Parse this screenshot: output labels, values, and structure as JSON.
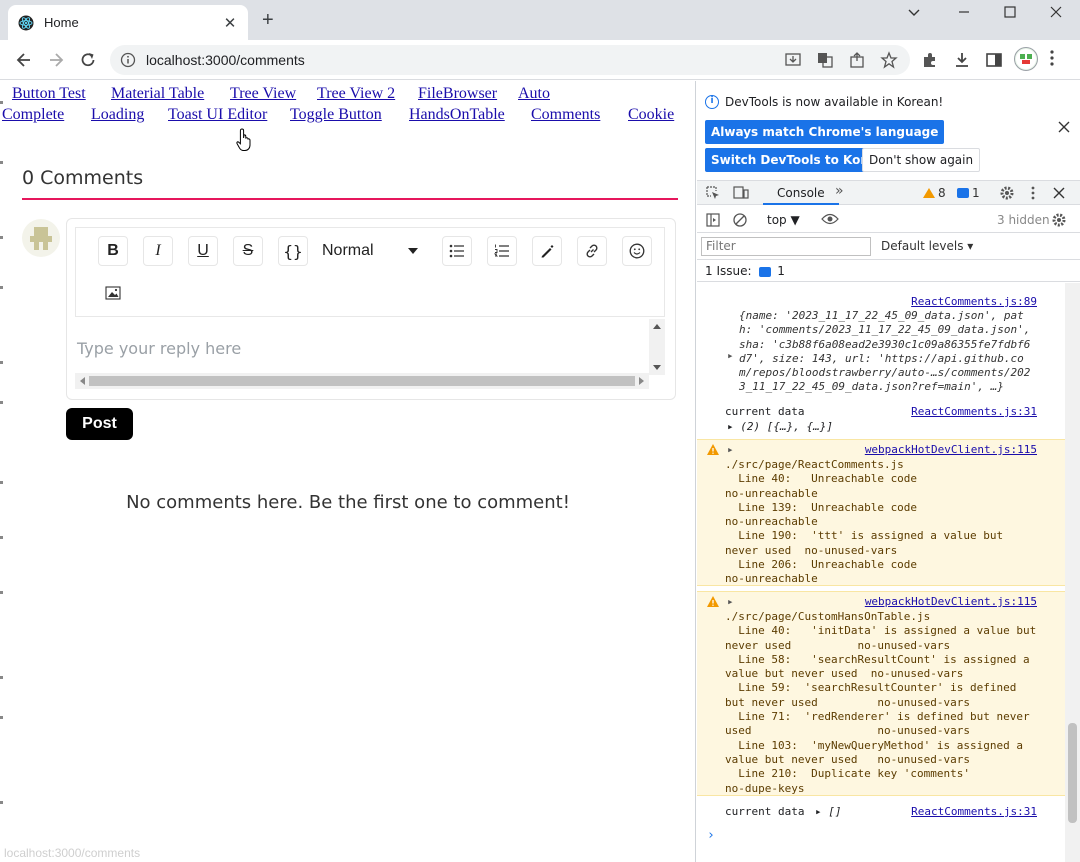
{
  "browser": {
    "tab_title": "Home",
    "tab_close": "✕",
    "new_tab": "+",
    "url": "localhost:3000/comments"
  },
  "nav_links": [
    "Button Test",
    "Material Table",
    "Tree View",
    "Tree View 2",
    "FileBrowser",
    "Auto",
    "Complete",
    "Loading",
    "Toast UI Editor",
    "Toggle Button",
    "HandsOnTable",
    "Comments",
    "Cookie"
  ],
  "comments": {
    "title": "0 Comments",
    "format_select": "Normal",
    "placeholder": "Type your reply here",
    "post_label": "Post",
    "empty_message": "No comments here. Be the first one to comment!",
    "status_url": "localhost:3000/comments"
  },
  "editor_toolbar": {
    "bold": "B",
    "italic": "I",
    "underline": "U",
    "strike": "S",
    "code": "{}"
  },
  "devtools": {
    "banner_text": "DevTools is now available in Korean!",
    "btn_match": "Always match Chrome's language",
    "btn_switch": "Switch DevTools to Korean",
    "btn_dont_show": "Don't show again",
    "tab_console": "Console",
    "warn_count": "8",
    "msg_count": "1",
    "context": "top",
    "hidden": "3 hidden",
    "filter_placeholder": "Filter",
    "levels": "Default levels",
    "issues_label": "1 Issue:",
    "issues_count": "1",
    "logs": {
      "e1_src": "ReactComments.js:89",
      "e1_lines": [
        "{name: '2023_11_17_22_45_09_data.json', pat",
        "h: 'comments/2023_11_17_22_45_09_data.json',",
        "sha: 'c3b88f6a08ead2e3930c1c09a86355fe7fdbf6",
        "d7', size: 143, url: 'https://api.github.co",
        "m/repos/bloodstrawberry/auto-…s/comments/202",
        "3_11_17_22_45_09_data.json?ref=main', …}"
      ],
      "e2_label": "current data",
      "e2_src": "ReactComments.js:31",
      "e2_value": "(2) [{…}, {…}]",
      "w1_src": "webpackHotDevClient.js:115",
      "w1_lines": [
        "./src/page/ReactComments.js",
        "  Line 40:   Unreachable code",
        "no-unreachable",
        "  Line 139:  Unreachable code",
        "no-unreachable",
        "  Line 190:  'ttt' is assigned a value but",
        "never used  no-unused-vars",
        "  Line 206:  Unreachable code",
        "no-unreachable"
      ],
      "w2_src": "webpackHotDevClient.js:115",
      "w2_lines": [
        "./src/page/CustomHansOnTable.js",
        "  Line 40:   'initData' is assigned a value but",
        "never used          no-unused-vars",
        "  Line 58:   'searchResultCount' is assigned a",
        "value but never used  no-unused-vars",
        "  Line 59:  'searchResultCounter' is defined",
        "but never used         no-unused-vars",
        "  Line 71:  'redRenderer' is defined but never",
        "used                   no-unused-vars",
        "  Line 103:  'myNewQueryMethod' is assigned a",
        "value but never used   no-unused-vars",
        "  Line 210:  Duplicate key 'comments'",
        "no-dupe-keys"
      ],
      "e3_label": "current data",
      "e3_value": "[]",
      "e3_src": "ReactComments.js:31"
    }
  },
  "colors": {
    "accent_rule": "#e6175c",
    "link": "#1a0dab",
    "devtools_blue": "#1a73e8",
    "warn_bg": "#fef7e0"
  }
}
